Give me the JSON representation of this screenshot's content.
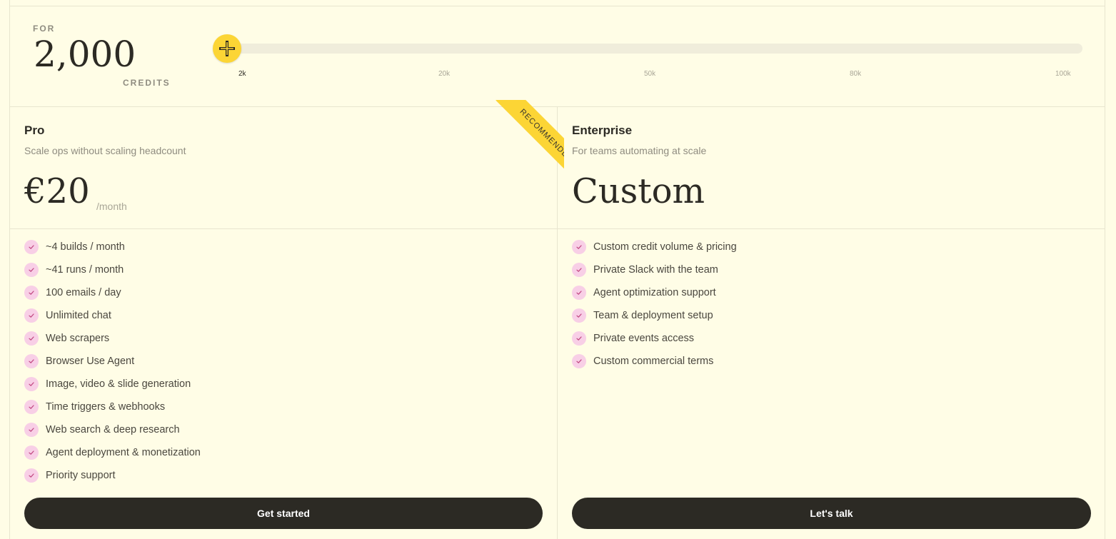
{
  "credits": {
    "for_label": "FOR",
    "value": "2,000",
    "unit_label": "CREDITS",
    "slider": {
      "level": 0,
      "ticks": [
        "2k",
        "20k",
        "50k",
        "80k",
        "100k"
      ],
      "active_tick": "2k"
    }
  },
  "plans": [
    {
      "name": "Pro",
      "subtitle": "Scale ops without scaling headcount",
      "price": "€20",
      "period": "/month",
      "badge": "RECOMMENDED",
      "features": [
        "~4 builds / month",
        "~41 runs / month",
        "100 emails / day",
        "Unlimited chat",
        "Web scrapers",
        "Browser Use Agent",
        "Image, video & slide generation",
        "Time triggers & webhooks",
        "Web search & deep research",
        "Agent deployment & monetization",
        "Priority support"
      ],
      "cta": "Get started"
    },
    {
      "name": "Enterprise",
      "subtitle": "For teams automating at scale",
      "price": "Custom",
      "features": [
        "Custom credit volume & pricing",
        "Private Slack with the team",
        "Agent optimization support",
        "Team & deployment setup",
        "Private events access",
        "Custom commercial terms"
      ],
      "cta": "Let's talk"
    }
  ],
  "colors": {
    "background": "#fffde6",
    "accent_yellow": "#fcd535",
    "check_pink": "#f8cfe6",
    "button_dark": "#2c2a24"
  },
  "icons": {
    "slider_thumb": "sparkle-cross-icon",
    "feature_check": "check-icon"
  }
}
